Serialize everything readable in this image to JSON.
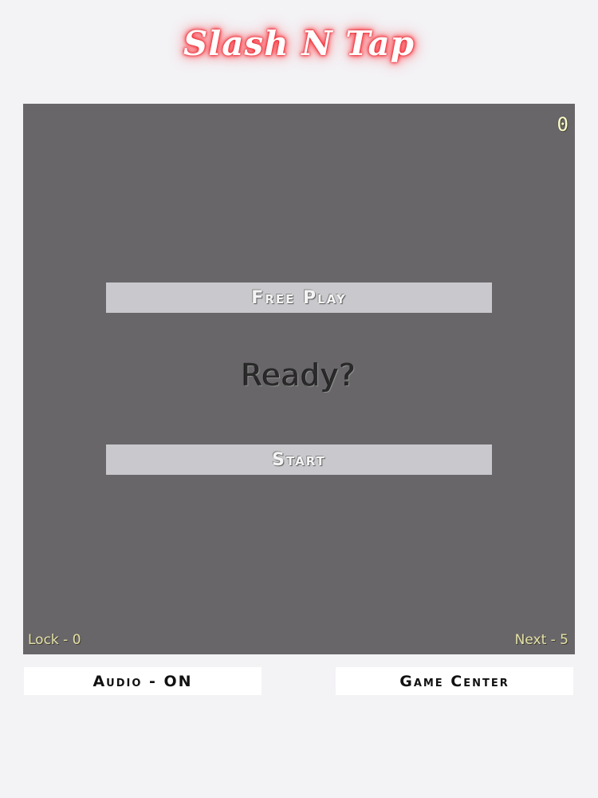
{
  "header": {
    "title": "Slash N Tap"
  },
  "board": {
    "score": "0",
    "free_play_label": "Free Play",
    "ready_text": "Ready?",
    "start_label": "Start",
    "lock_text": "Lock - 0",
    "next_text": "Next - 5"
  },
  "footer": {
    "audio_label": "Audio - ON",
    "game_center_label": "Game Center"
  },
  "colors": {
    "page_background": "#f3f2f5",
    "board_background": "#686669",
    "menu_button_background": "#c9c8cc",
    "title_glow": "#e8262f",
    "hud_text": "#e4e0a8"
  }
}
